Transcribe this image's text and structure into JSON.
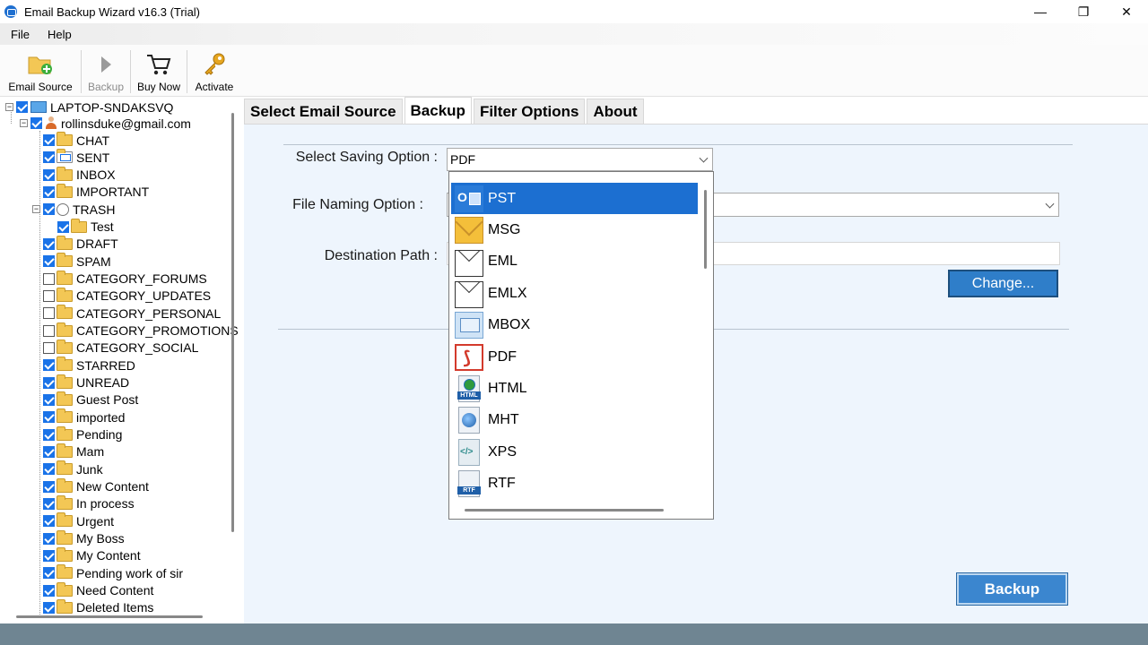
{
  "window": {
    "title": "Email Backup Wizard v16.3 (Trial)",
    "minimize": "—",
    "maximize": "❐",
    "close": "✕"
  },
  "menu": {
    "items": [
      "File",
      "Help"
    ]
  },
  "toolbar": {
    "email_source": "Email Source",
    "backup": "Backup",
    "buy_now": "Buy Now",
    "activate": "Activate"
  },
  "tree": {
    "root": "LAPTOP-SNDAKSVQ",
    "account": "rollinsduke@gmail.com",
    "folders": [
      {
        "label": "CHAT",
        "checked": true
      },
      {
        "label": "SENT",
        "checked": true
      },
      {
        "label": "INBOX",
        "checked": true
      },
      {
        "label": "IMPORTANT",
        "checked": true
      },
      {
        "label": "TRASH",
        "checked": true
      },
      {
        "label": "Test",
        "checked": true
      },
      {
        "label": "DRAFT",
        "checked": true
      },
      {
        "label": "SPAM",
        "checked": true
      },
      {
        "label": "CATEGORY_FORUMS",
        "checked": false
      },
      {
        "label": "CATEGORY_UPDATES",
        "checked": false
      },
      {
        "label": "CATEGORY_PERSONAL",
        "checked": false
      },
      {
        "label": "CATEGORY_PROMOTIONS",
        "checked": false
      },
      {
        "label": "CATEGORY_SOCIAL",
        "checked": false
      },
      {
        "label": "STARRED",
        "checked": true
      },
      {
        "label": "UNREAD",
        "checked": true
      },
      {
        "label": "Guest Post",
        "checked": true
      },
      {
        "label": "imported",
        "checked": true
      },
      {
        "label": "Pending",
        "checked": true
      },
      {
        "label": "Mam",
        "checked": true
      },
      {
        "label": "Junk",
        "checked": true
      },
      {
        "label": "New Content",
        "checked": true
      },
      {
        "label": "In process",
        "checked": true
      },
      {
        "label": "Urgent",
        "checked": true
      },
      {
        "label": "My Boss",
        "checked": true
      },
      {
        "label": "My Content",
        "checked": true
      },
      {
        "label": "Pending work of sir",
        "checked": true
      },
      {
        "label": "Need Content",
        "checked": true
      },
      {
        "label": "Deleted Items",
        "checked": true
      }
    ]
  },
  "tabs": [
    "Select Email Source",
    "Backup",
    "Filter Options",
    "About"
  ],
  "form": {
    "saving_label": "Select Saving Option :",
    "saving_value": "PDF",
    "naming_label": "File Naming Option :",
    "naming_value": "",
    "dest_label": "Destination Path :",
    "dest_value": "",
    "change_button": "Change...",
    "backup_button": "Backup"
  },
  "dropdown": {
    "selected": "PST",
    "options": [
      {
        "label": "PST",
        "icon": "pst-icon"
      },
      {
        "label": "MSG",
        "icon": "msg-icon"
      },
      {
        "label": "EML",
        "icon": "eml-icon"
      },
      {
        "label": "EMLX",
        "icon": "emlx-icon"
      },
      {
        "label": "MBOX",
        "icon": "mbox-icon"
      },
      {
        "label": "PDF",
        "icon": "pdf-icon"
      },
      {
        "label": "HTML",
        "icon": "html-icon",
        "tag": "HTML"
      },
      {
        "label": "MHT",
        "icon": "mht-icon"
      },
      {
        "label": "XPS",
        "icon": "xps-icon"
      },
      {
        "label": "RTF",
        "icon": "rtf-icon",
        "tag": "RTF"
      }
    ]
  }
}
